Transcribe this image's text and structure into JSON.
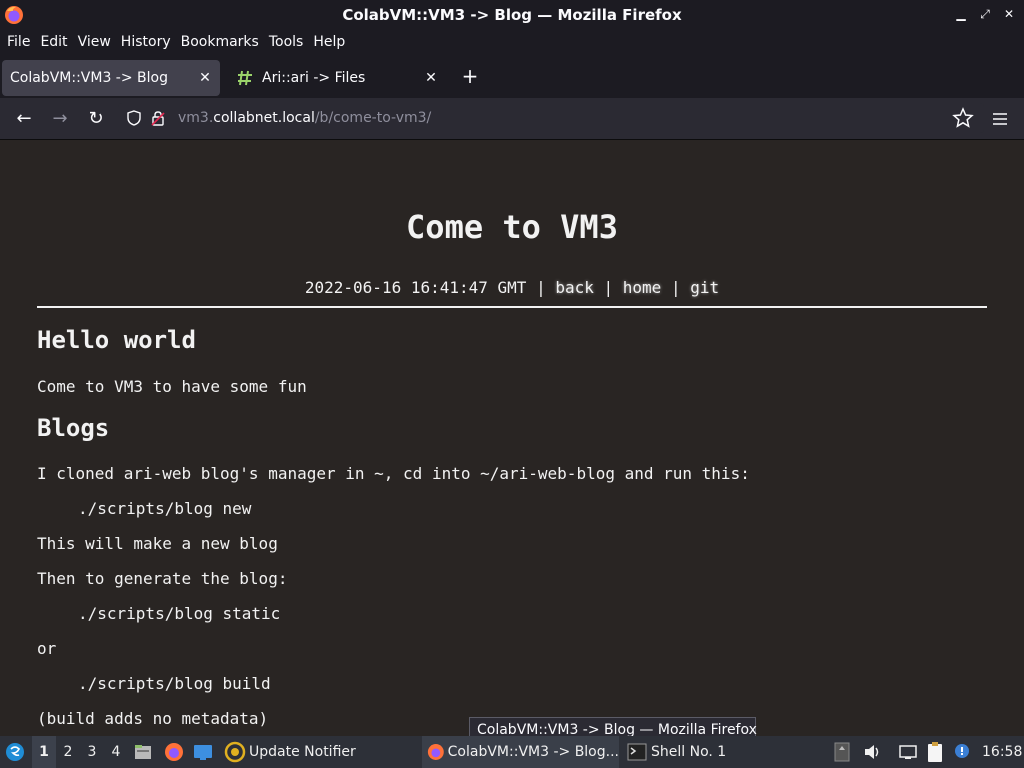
{
  "window": {
    "title": "ColabVM::VM3 -> Blog — Mozilla Firefox",
    "controls": [
      "minimize",
      "maximize",
      "close"
    ]
  },
  "menu": [
    "File",
    "Edit",
    "View",
    "History",
    "Bookmarks",
    "Tools",
    "Help"
  ],
  "tabs": [
    {
      "label": "ColabVM::VM3 -> Blog",
      "active": true
    },
    {
      "label": "Ari::ari -> Files",
      "active": false
    }
  ],
  "new_tab_label": "+",
  "nav": {
    "url_host_prefix": "vm3.",
    "url_host": "collabnet.local",
    "url_path": "/b/come-to-vm3/"
  },
  "page": {
    "title": "Come to VM3",
    "timestamp": "2022-06-16 16:41:47 GMT",
    "sep1": " | ",
    "link_back": "back",
    "sep2": " | ",
    "link_home": "home",
    "sep3": " | ",
    "link_git": "git",
    "h_hello": "Hello world",
    "p_intro": "Come to VM3 to have some fun",
    "h_blogs": "Blogs",
    "p_cloned": "I cloned ari-web blog's manager in ~, cd into ~/ari-web-blog and run this:",
    "code_new": "./scripts/blog new",
    "p_new_blog": "This will make a new blog",
    "p_generate": "Then to generate the blog:",
    "code_static": "./scripts/blog static",
    "p_or": "or",
    "code_build": "./scripts/blog build",
    "p_build_note": "(build adds no metadata)"
  },
  "tooltip": "ColabVM::VM3 -> Blog — Mozilla Firefox",
  "taskbar": {
    "workspaces": [
      "1",
      "2",
      "3",
      "4"
    ],
    "update_notifier": "Update Notifier",
    "firefox_task": "ColabVM::VM3 -> Blog...",
    "shell_task": "Shell No. 1",
    "clock": "16:58"
  }
}
